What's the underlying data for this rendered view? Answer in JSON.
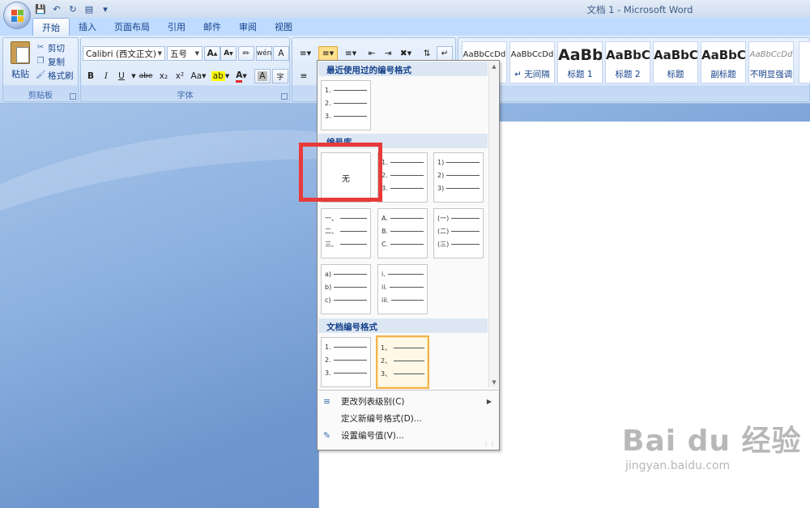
{
  "window": {
    "title": "文档 1 - Microsoft Word"
  },
  "tabs": [
    "开始",
    "插入",
    "页面布局",
    "引用",
    "邮件",
    "审阅",
    "视图"
  ],
  "clipboard": {
    "paste_label": "粘贴",
    "cut_label": "剪切",
    "copy_label": "复制",
    "format_painter_label": "格式刷",
    "group_label": "剪贴板"
  },
  "font": {
    "font_name": "Calibri (西文正文)",
    "font_size": "五号",
    "group_label": "字体",
    "btn_bold": "B",
    "btn_italic": "I",
    "btn_underline": "U",
    "btn_strike": "abe",
    "btn_sub": "x₂",
    "btn_sup": "x²",
    "btn_case": "Aa",
    "btn_grow": "A",
    "btn_shrink": "A",
    "btn_phonetic": "wén",
    "btn_char_border": "A",
    "btn_font_color": "A",
    "btn_shading": "A",
    "btn_encircle": "字"
  },
  "styles": {
    "items": [
      {
        "sample": "AaBbCcDd",
        "name": ""
      },
      {
        "sample": "AaBbCcDd",
        "name": "↵ 无间隔"
      },
      {
        "sample": "AaBb",
        "name": "标题 1"
      },
      {
        "sample": "AaBbC",
        "name": "标题 2"
      },
      {
        "sample": "AaBbC",
        "name": "标题"
      },
      {
        "sample": "AaBbC",
        "name": "副标题"
      },
      {
        "sample": "AaBbCcDd",
        "name": "不明显强调"
      }
    ]
  },
  "numbering_menu": {
    "section_recent": "最近使用过的编号格式",
    "section_library": "编号库",
    "section_document": "文档编号格式",
    "none_label": "无",
    "recent": [
      [
        "1.",
        "2.",
        "3."
      ]
    ],
    "library": [
      [
        "1.",
        "2.",
        "3."
      ],
      [
        "1)",
        "2)",
        "3)"
      ],
      [
        "一、",
        "二、",
        "三、"
      ],
      [
        "A.",
        "B.",
        "C."
      ],
      [
        "(一)",
        "(二)",
        "(三)"
      ],
      [
        "a)",
        "b)",
        "c)"
      ],
      [
        "i.",
        "ii.",
        "iii."
      ]
    ],
    "document": [
      [
        "1.",
        "2.",
        "3."
      ],
      [
        "1、",
        "2、",
        "3、"
      ]
    ],
    "menu_items": [
      {
        "label": "更改列表级别(C)",
        "icon": "change-list-level-icon"
      },
      {
        "label": "定义新编号格式(D)...",
        "icon": ""
      },
      {
        "label": "设置编号值(V)...",
        "icon": "set-numbering-value-icon"
      }
    ]
  },
  "watermark": {
    "main": "Bai du 经验",
    "sub": "jingyan.baidu.com"
  }
}
